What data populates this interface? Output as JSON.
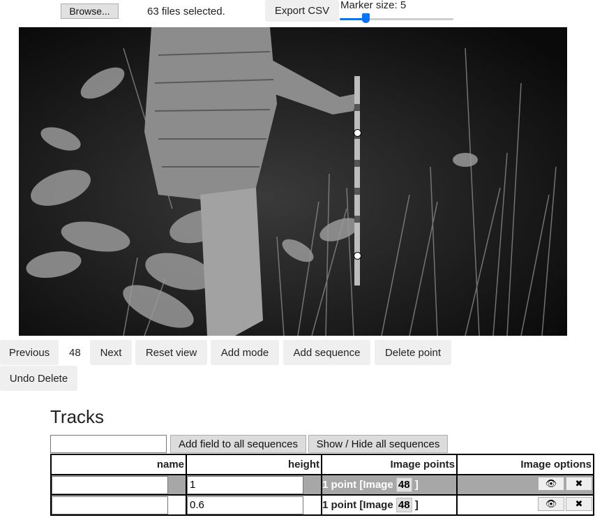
{
  "toolbar": {
    "browse_label": "Browse...",
    "files_status": "63 files selected.",
    "export_label": "Export CSV",
    "marker_size_label": "Marker size: 5",
    "marker_size_value": 5
  },
  "nav": {
    "previous_label": "Previous",
    "image_index": "48",
    "next_label": "Next",
    "reset_view_label": "Reset view",
    "add_mode_label": "Add mode",
    "add_sequence_label": "Add sequence",
    "delete_point_label": "Delete point",
    "undo_delete_label": "Undo Delete"
  },
  "tracks": {
    "heading": "Tracks",
    "new_field_value": "",
    "add_field_label": "Add field to all sequences",
    "show_hide_label": "Show / Hide all sequences",
    "columns": [
      "name",
      "height",
      "Image points",
      "Image options"
    ],
    "rows": [
      {
        "name": "",
        "height": "1",
        "points_prefix": "1 point [Image",
        "image": "48",
        "points_suffix": "]",
        "eye": "👁",
        "close": "✖",
        "highlighted": true
      },
      {
        "name": "",
        "height": "0.6",
        "points_prefix": "1 point [Image",
        "image": "48",
        "points_suffix": "]",
        "eye": "👁",
        "close": "✖",
        "highlighted": false
      }
    ]
  }
}
